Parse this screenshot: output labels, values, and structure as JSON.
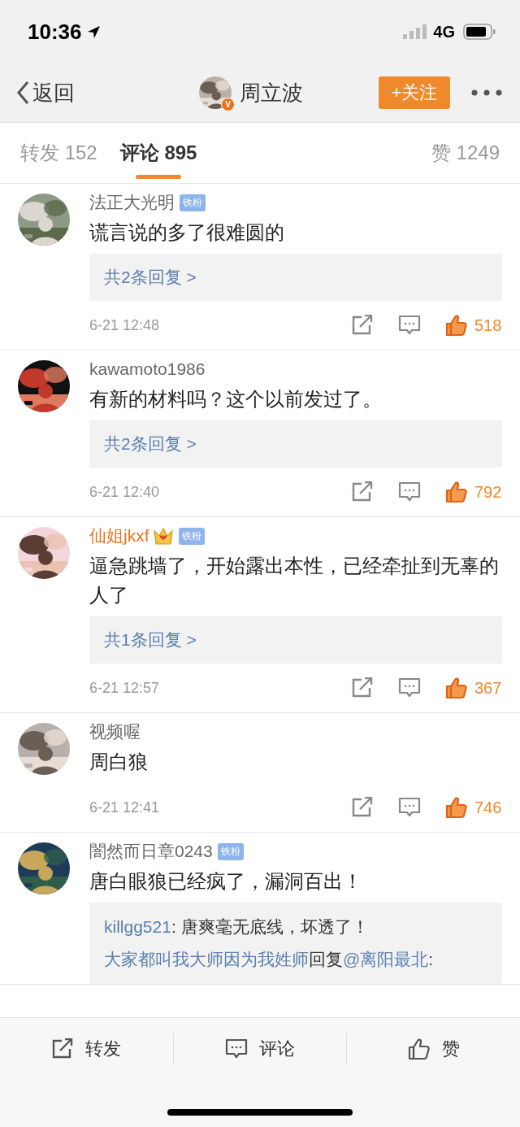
{
  "status_bar": {
    "time": "10:36",
    "network": "4G"
  },
  "nav": {
    "back": "返回",
    "author": "周立波",
    "verified_badge": "V",
    "follow": "+关注"
  },
  "tabs": [
    {
      "label": "转发 152",
      "selected": false
    },
    {
      "label": "评论 895",
      "selected": true
    },
    {
      "label": "赞 1249",
      "selected": false
    }
  ],
  "comments": [
    {
      "user": "法正大光明",
      "vip": false,
      "badge": "铁粉",
      "text": "谎言说的多了很难圆的",
      "replies_link": "共2条回复 >",
      "time": "6-21 12:48",
      "likes": "518"
    },
    {
      "user": "kawamoto1986",
      "vip": false,
      "text": "有新的材料吗？这个以前发过了。",
      "replies_link": "共2条回复 >",
      "time": "6-21 12:40",
      "likes": "792"
    },
    {
      "user": "仙姐jkxf",
      "vip": true,
      "badge": "铁粉",
      "text": "逼急跳墙了，开始露出本性，已经牵扯到无辜的人了",
      "replies_link": "共1条回复 >",
      "time": "6-21 12:57",
      "likes": "367"
    },
    {
      "user": "视频喔",
      "vip": false,
      "text": "周白狼",
      "time": "6-21 12:41",
      "likes": "746"
    },
    {
      "user": "闇然而日章0243",
      "vip": false,
      "badge": "铁粉",
      "text": "唐白眼狼已经疯了，漏洞百出！",
      "replies": [
        [
          {
            "kind": "user",
            "text": "killgg521"
          },
          {
            "kind": "plain",
            "text": ": 唐爽毫无底线，坏透了！"
          }
        ],
        [
          {
            "kind": "user",
            "text": "大家都叫我大师因为我姓师"
          },
          {
            "kind": "plain",
            "text": "回复"
          },
          {
            "kind": "user",
            "text": "@离阳最北"
          },
          {
            "kind": "plain",
            "text": ":"
          }
        ]
      ]
    }
  ],
  "bottom_bar": [
    {
      "label": "转发"
    },
    {
      "label": "评论"
    },
    {
      "label": "赞"
    }
  ]
}
